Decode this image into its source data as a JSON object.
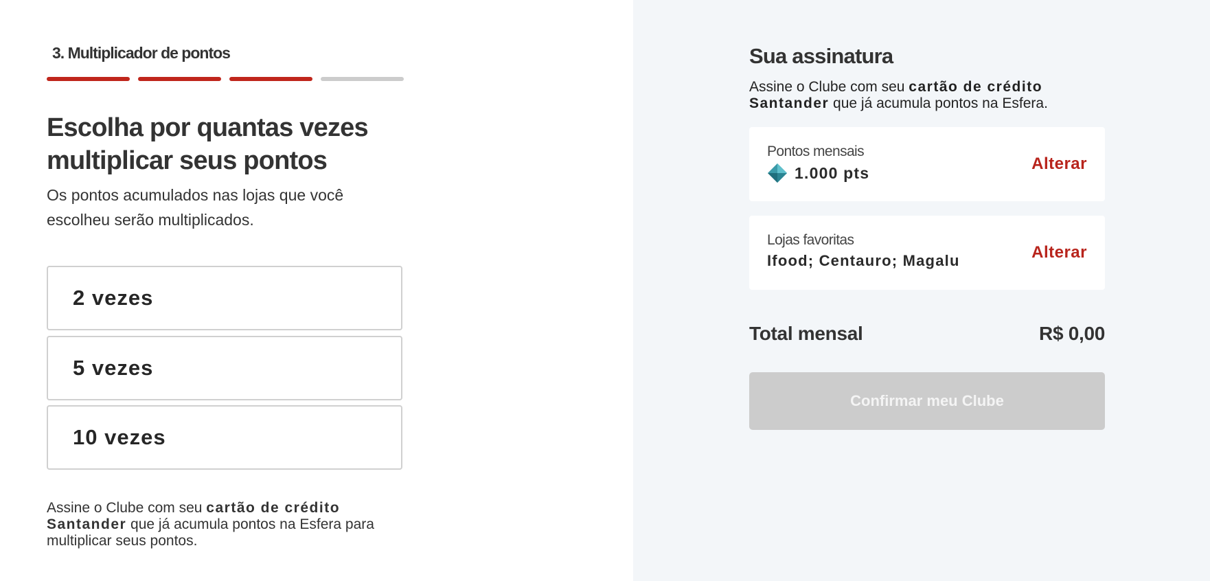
{
  "stepper": {
    "title": "3. Multiplicador de pontos",
    "segments": [
      true,
      true,
      true,
      false
    ]
  },
  "main": {
    "heading": "Escolha por quantas vezes multiplicar seus pontos",
    "subtitle": "Os pontos acumulados nas lojas que você escolheu serão multiplicados.",
    "options": [
      {
        "label": "2 vezes"
      },
      {
        "label": "5 vezes"
      },
      {
        "label": "10 vezes"
      }
    ],
    "footnote": {
      "prefix": "Assine o Clube com seu ",
      "bold": "cartão de crédito Santander",
      "suffix": " que já acumula pontos na Esfera para multiplicar seus pontos."
    }
  },
  "summary": {
    "title": "Sua assinatura",
    "description": {
      "prefix": "Assine o Clube com seu ",
      "bold": "cartão de crédito Santander",
      "suffix": " que já acumula pontos na Esfera."
    },
    "points_card": {
      "label": "Pontos mensais",
      "icon": "gem-icon",
      "value": "1.000 pts",
      "action": "Alterar"
    },
    "stores_card": {
      "label": "Lojas favoritas",
      "value": "Ifood; Centauro; Magalu",
      "action": "Alterar"
    },
    "total_label": "Total mensal",
    "total_value": "R$ 0,00",
    "confirm_label": "Confirmar meu Clube"
  },
  "colors": {
    "accent": "#c0261c",
    "action": "#b8241c",
    "panel_bg": "#f3f6f9",
    "disabled_button": "#cccccc",
    "gem": "#3a9aa8"
  }
}
